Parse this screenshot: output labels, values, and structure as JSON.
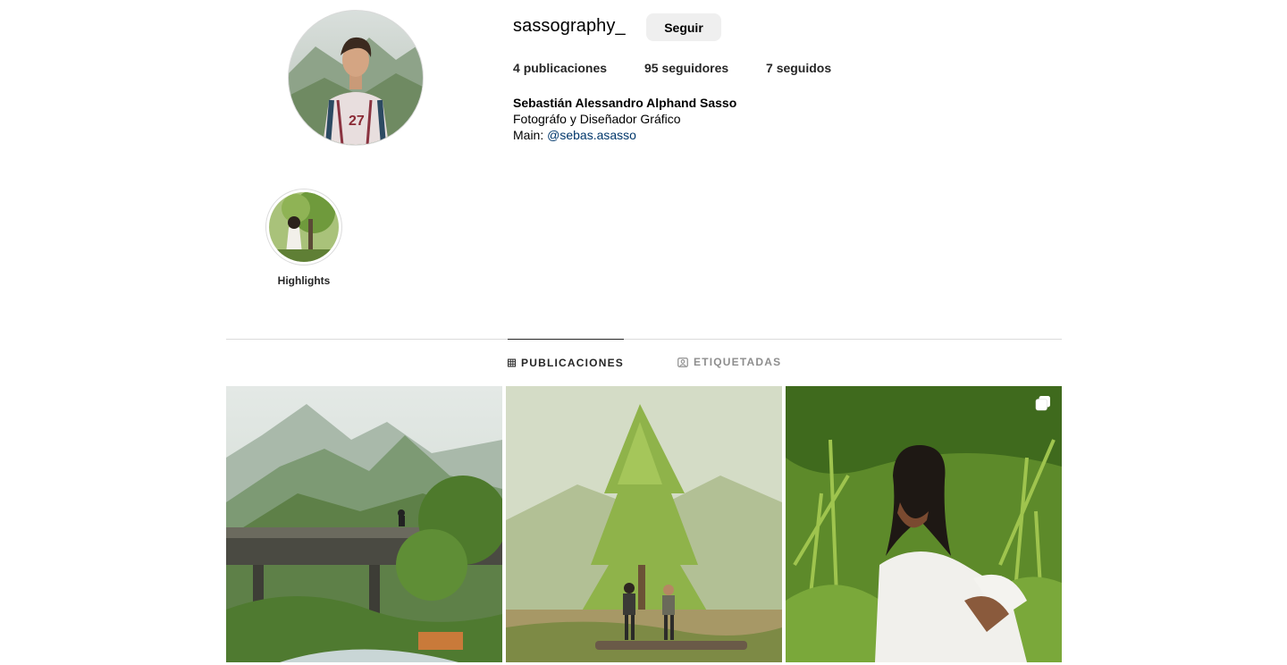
{
  "profile": {
    "username": "sassography_",
    "follow_label": "Seguir",
    "stats": {
      "posts_count": "4",
      "posts_label": "publicaciones",
      "followers_count": "95",
      "followers_label": "seguidores",
      "following_count": "7",
      "following_label": "seguidos"
    },
    "bio": {
      "full_name": "Sebastián Alessandro Alphand Sasso",
      "line1": "Fotográfo y Diseñador Gráfico",
      "line2_prefix": "Main: ",
      "mention": "@sebas.asasso"
    }
  },
  "highlights": [
    {
      "label": "Highlights"
    }
  ],
  "tabs": [
    {
      "label": "PUBLICACIONES",
      "icon": "grid-icon",
      "active": true
    },
    {
      "label": "ETIQUETADAS",
      "icon": "tagged-icon",
      "active": false
    }
  ],
  "posts": [
    {
      "subject": "mountain-bridge-river",
      "carousel": false
    },
    {
      "subject": "couple-by-tree",
      "carousel": false
    },
    {
      "subject": "woman-in-grass",
      "carousel": true
    }
  ],
  "colors": {
    "link": "#00376b",
    "button_bg": "#efefef",
    "divider": "#dbdbdb"
  }
}
